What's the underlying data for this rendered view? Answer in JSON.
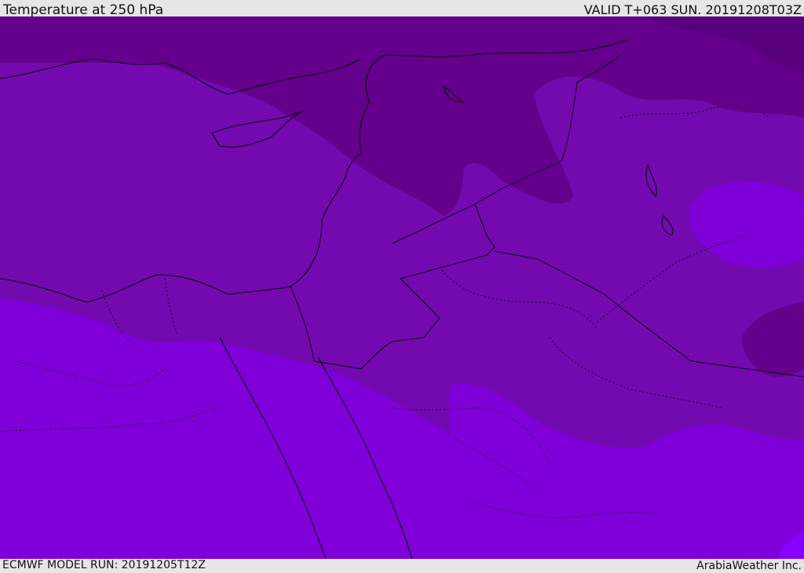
{
  "header": {
    "title": "Temperature at 250 hPa",
    "valid": "VALID T+063 SUN. 20191208T03Z"
  },
  "footer": {
    "model_run": "ECMWF MODEL RUN: 20191205T12Z",
    "credit": "ArabiaWeather Inc."
  },
  "colors": {
    "band_darkest": "#59007f",
    "band_dark": "#65008c",
    "band_mid": "#720ab0",
    "band_light": "#7f00d9",
    "band_brightest": "#8a00ff",
    "borders": "#000000"
  }
}
